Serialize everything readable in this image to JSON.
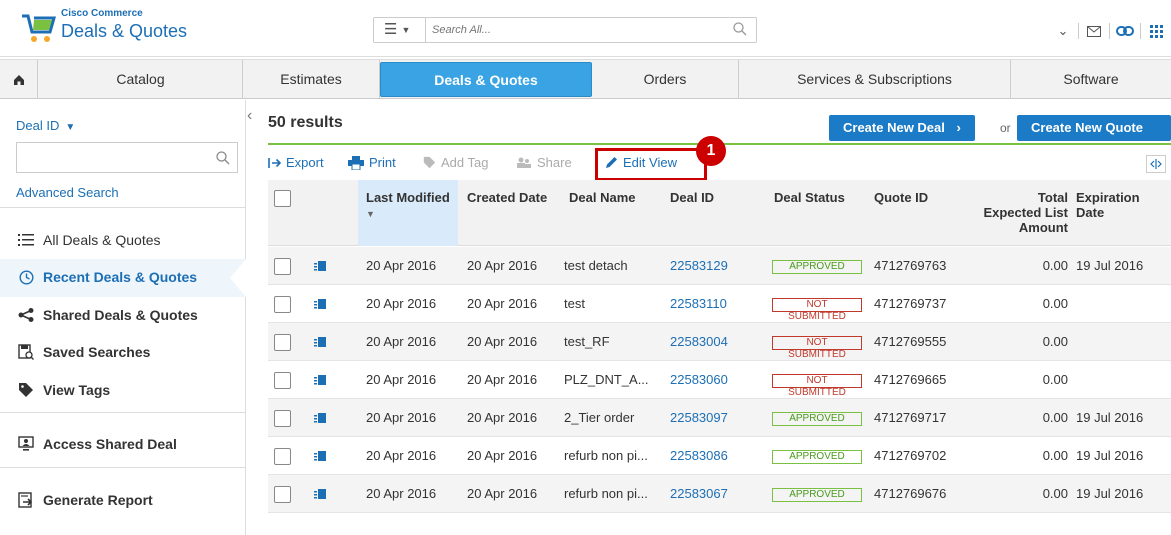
{
  "header": {
    "brand_small": "Cisco Commerce",
    "brand_title": "Deals & Quotes",
    "search_placeholder": "Search All..."
  },
  "nav": {
    "tabs": [
      {
        "label": "Catalog"
      },
      {
        "label": "Estimates"
      },
      {
        "label": "Deals & Quotes"
      },
      {
        "label": "Orders"
      },
      {
        "label": "Services & Subscriptions"
      },
      {
        "label": "Software"
      }
    ],
    "active_tab": "Deals & Quotes"
  },
  "sidebar": {
    "filter_label": "Deal ID",
    "advanced_search": "Advanced Search",
    "items": [
      {
        "label": "All Deals & Quotes",
        "icon": "list-icon"
      },
      {
        "label": "Recent Deals & Quotes",
        "icon": "clock-icon"
      },
      {
        "label": "Shared Deals & Quotes",
        "icon": "share-icon"
      },
      {
        "label": "Saved Searches",
        "icon": "saved-search-icon"
      },
      {
        "label": "View Tags",
        "icon": "tag-icon"
      },
      {
        "label": "Access Shared Deal",
        "icon": "monitor-icon"
      },
      {
        "label": "Generate Report",
        "icon": "report-icon"
      }
    ],
    "selected": "Recent Deals & Quotes"
  },
  "main": {
    "results": "50 results",
    "create_deal": "Create New Deal",
    "or": "or",
    "create_quote": "Create New Quote",
    "toolbar": {
      "export": "Export",
      "print": "Print",
      "add_tag": "Add Tag",
      "share": "Share",
      "edit_view": "Edit View"
    },
    "callout": "1",
    "columns": {
      "last_modified": "Last Modified",
      "created_date": "Created Date",
      "deal_name": "Deal Name",
      "deal_id": "Deal ID",
      "deal_status": "Deal Status",
      "quote_id": "Quote ID",
      "total_1": "Total",
      "total_2": "Expected List",
      "total_3": "Amount",
      "exp_1": "Expiration",
      "exp_2": "Date"
    },
    "rows": [
      {
        "last_modified": "20 Apr 2016",
        "created": "20 Apr 2016",
        "name": "test detach",
        "deal_id": "22583129",
        "status": "APPROVED",
        "quote_id": "4712769763",
        "amount": "0.00",
        "expiration": "19 Jul 2016"
      },
      {
        "last_modified": "20 Apr 2016",
        "created": "20 Apr 2016",
        "name": "test",
        "deal_id": "22583110",
        "status": "NOT SUBMITTED",
        "quote_id": "4712769737",
        "amount": "0.00",
        "expiration": ""
      },
      {
        "last_modified": "20 Apr 2016",
        "created": "20 Apr 2016",
        "name": "test_RF",
        "deal_id": "22583004",
        "status": "NOT SUBMITTED",
        "quote_id": "4712769555",
        "amount": "0.00",
        "expiration": ""
      },
      {
        "last_modified": "20 Apr 2016",
        "created": "20 Apr 2016",
        "name": "PLZ_DNT_A...",
        "deal_id": "22583060",
        "status": "NOT SUBMITTED",
        "quote_id": "4712769665",
        "amount": "0.00",
        "expiration": ""
      },
      {
        "last_modified": "20 Apr 2016",
        "created": "20 Apr 2016",
        "name": "2_Tier order",
        "deal_id": "22583097",
        "status": "APPROVED",
        "quote_id": "4712769717",
        "amount": "0.00",
        "expiration": "19 Jul 2016"
      },
      {
        "last_modified": "20 Apr 2016",
        "created": "20 Apr 2016",
        "name": "refurb non pi...",
        "deal_id": "22583086",
        "status": "APPROVED",
        "quote_id": "4712769702",
        "amount": "0.00",
        "expiration": "19 Jul 2016"
      },
      {
        "last_modified": "20 Apr 2016",
        "created": "20 Apr 2016",
        "name": "refurb non pi...",
        "deal_id": "22583067",
        "status": "APPROVED",
        "quote_id": "4712769676",
        "amount": "0.00",
        "expiration": "19 Jul 2016"
      }
    ]
  },
  "colors": {
    "accent": "#3aa3e3",
    "link": "#1c6fb5",
    "approved": "#4a9a1c",
    "not_submitted": "#c0392b",
    "highlight": "#cc0000"
  }
}
